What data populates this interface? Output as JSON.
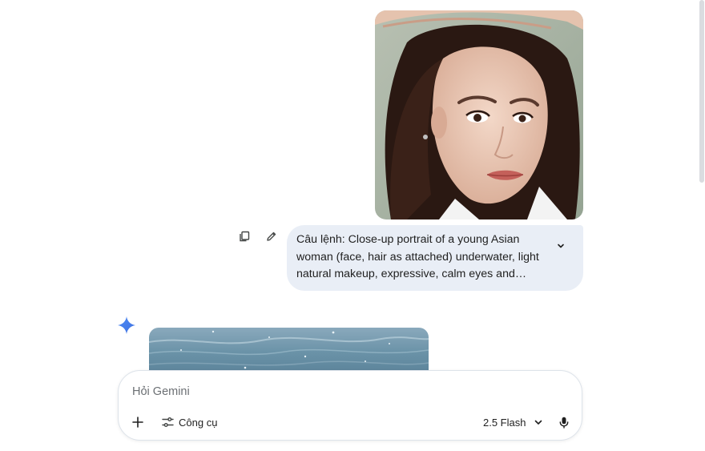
{
  "conversation": {
    "user_prompt": "Câu lệnh: Close-up portrait of a young Asian woman (face, hair as attached) underwater, light natural makeup, expressive, calm eyes and natural red lips. Th..."
  },
  "input": {
    "placeholder": "Hỏi Gemini",
    "value": ""
  },
  "toolbar": {
    "tools_label": "Công cụ",
    "model_label": "2.5 Flash"
  },
  "colors": {
    "bubble_bg": "#e9eef6",
    "gemini_blue": "#4285f4",
    "border": "#dde3ea"
  },
  "icons": [
    "copy-icon",
    "edit-icon",
    "chevron-down-icon",
    "gemini-sparkle-icon",
    "plus-icon",
    "tune-icon",
    "microphone-icon"
  ]
}
